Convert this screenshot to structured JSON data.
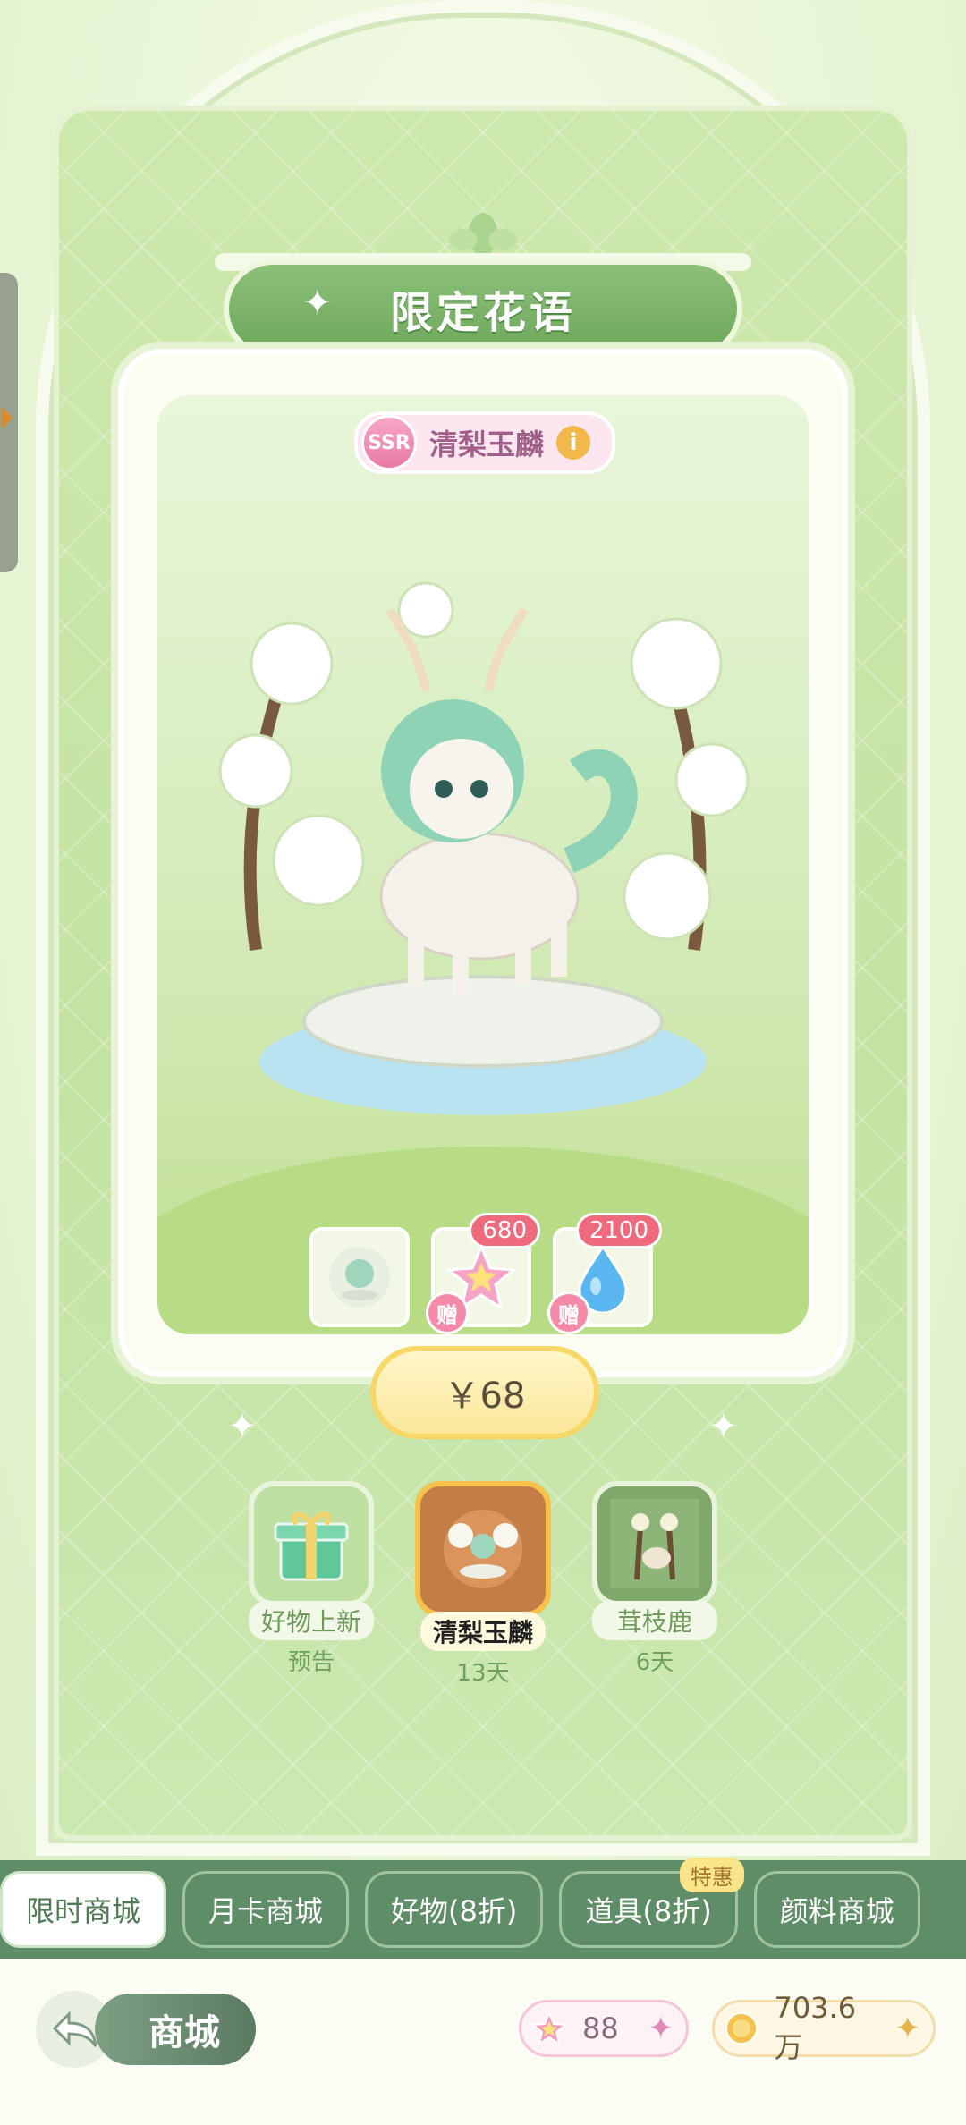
{
  "header": {
    "title": "限定花语"
  },
  "featured": {
    "rarity": "SSR",
    "name": "清梨玉麟",
    "rewards": [
      {
        "kind": "qilin-figure"
      },
      {
        "kind": "pink-star",
        "count": "680",
        "gift_label": "赠"
      },
      {
        "kind": "blue-drop",
        "count": "2100",
        "gift_label": "赠"
      }
    ],
    "price": "￥68"
  },
  "packs": [
    {
      "label": "好物上新",
      "sub": "预告",
      "active": false
    },
    {
      "label": "清梨玉麟",
      "sub": "13天",
      "active": true
    },
    {
      "label": "茸枝鹿",
      "sub": "6天",
      "active": false
    }
  ],
  "tabs": [
    {
      "label": "限时商城",
      "active": true
    },
    {
      "label": "月卡商城",
      "active": false
    },
    {
      "label": "好物(8折)",
      "active": false
    },
    {
      "label": "道具(8折)",
      "active": false,
      "badge": "特惠"
    },
    {
      "label": "颜料商城",
      "active": false
    }
  ],
  "footer": {
    "store_label": "商城",
    "star_amount": "88",
    "coin_amount": "703.6万"
  },
  "colors": {
    "accent_green": "#6ea85c",
    "tab_bar": "#5f8d67",
    "price_gold": "#f7d867"
  }
}
